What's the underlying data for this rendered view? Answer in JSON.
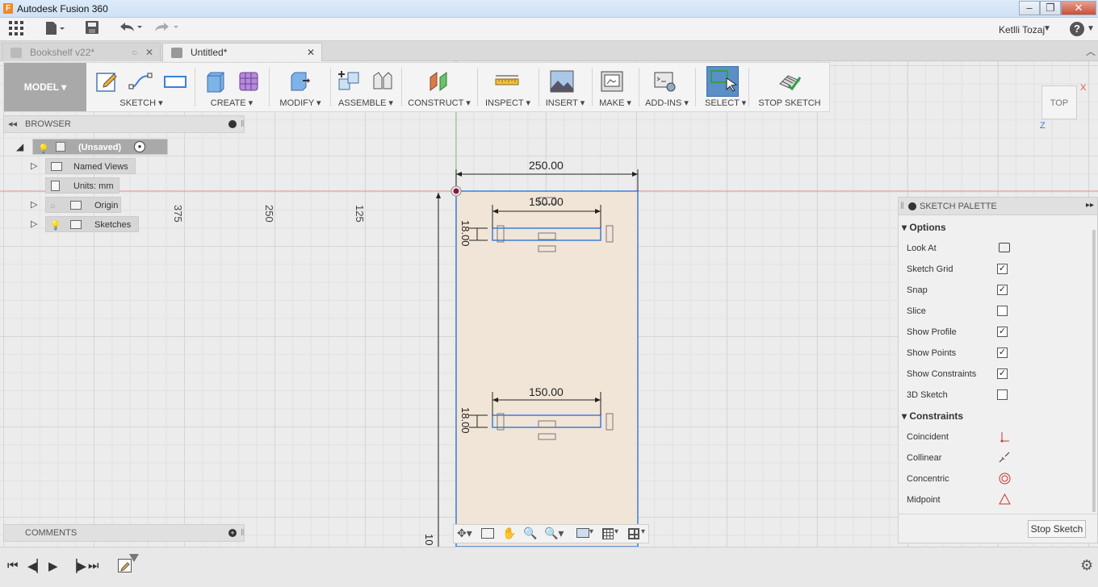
{
  "window": {
    "title": "Autodesk Fusion 360"
  },
  "user": {
    "name": "Ketlli Tozaj"
  },
  "tabs": [
    {
      "label": "Bookshelf v22*"
    },
    {
      "label": "Untitled*"
    }
  ],
  "ribbon": {
    "mode": "MODEL",
    "groups": [
      "SKETCH",
      "CREATE",
      "MODIFY",
      "ASSEMBLE",
      "CONSTRUCT",
      "INSPECT",
      "INSERT",
      "MAKE",
      "ADD-INS",
      "SELECT"
    ],
    "stop_sketch": "STOP SKETCH"
  },
  "browser": {
    "title": "BROWSER",
    "root": "(Unsaved)",
    "named_views": "Named Views",
    "units": "Units: mm",
    "origin": "Origin",
    "sketches": "Sketches"
  },
  "comments": {
    "title": "COMMENTS"
  },
  "viewcube": {
    "face": "TOP",
    "axis_x": "X",
    "axis_z": "Z"
  },
  "sketch": {
    "ruler_labels": [
      "375",
      "250",
      "125"
    ],
    "dimension_total": "250.00",
    "dimension_slot_top": "150.00",
    "dimension_slot_bottom": "150.00",
    "dimension_height_top": "18.00",
    "dimension_height_bottom": "18.00",
    "ruler_bottom": "10"
  },
  "palette": {
    "title": "SKETCH PALETTE",
    "options_header": "Options",
    "options": [
      {
        "label": "Look At",
        "type": "button"
      },
      {
        "label": "Sketch Grid",
        "checked": true
      },
      {
        "label": "Snap",
        "checked": true
      },
      {
        "label": "Slice",
        "checked": false
      },
      {
        "label": "Show Profile",
        "checked": true
      },
      {
        "label": "Show Points",
        "checked": true
      },
      {
        "label": "Show Constraints",
        "checked": true
      },
      {
        "label": "3D Sketch",
        "checked": false
      }
    ],
    "constraints_header": "Constraints",
    "constraints": [
      {
        "label": "Coincident",
        "icon": "coincident-icon"
      },
      {
        "label": "Collinear",
        "icon": "collinear-icon"
      },
      {
        "label": "Concentric",
        "icon": "concentric-icon"
      },
      {
        "label": "Midpoint",
        "icon": "midpoint-icon"
      }
    ],
    "stop_button": "Stop Sketch"
  },
  "colors": {
    "accent": "#3b7fd9",
    "sketch_fill": "#f1e4d5",
    "axis_red": "#e06060",
    "axis_green": "#6bc26b"
  }
}
